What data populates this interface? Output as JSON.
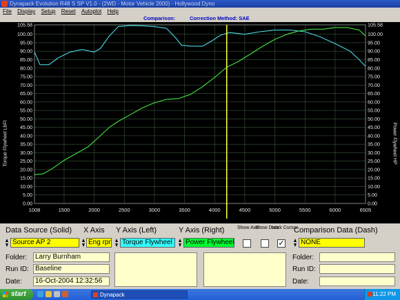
{
  "window": {
    "title": "Dynapack Evolution R48 S SP V1.0 - (2WD - Motor Vehicle 2000) - Hollywood Dyno"
  },
  "menu": [
    "File",
    "Display",
    "Setup",
    "Reset",
    "Autoplot",
    "Help"
  ],
  "comparison_bar": {
    "label": "Comparison:",
    "method": "Correction Method: SAE"
  },
  "colors": {
    "plot_bg": "#000000",
    "grid": "#3a5a3a",
    "torque": "#4ad8e8",
    "power": "#44e844",
    "cursor": "#ffff40",
    "field_yellow": "#ffff00",
    "field_cyan": "#33ffff",
    "field_green": "#00ff33"
  },
  "chart_data": {
    "type": "line",
    "title": "",
    "xlabel": "",
    "ylabel_left": "Torque Flywheel LbFt",
    "ylabel_right": "Power Flywheel HP",
    "xlim": [
      1008,
      6505
    ],
    "ylim": [
      0,
      105.58
    ],
    "x_ticks": [
      "1008",
      "1500",
      "2000",
      "2500",
      "3000",
      "3500",
      "4000",
      "4500",
      "5000",
      "5500",
      "6000",
      "6505"
    ],
    "y_ticks": [
      "105.58",
      "100.00",
      "95.00",
      "90.00",
      "85.00",
      "80.00",
      "75.00",
      "70.00",
      "65.00",
      "60.00",
      "55.00",
      "50.00",
      "45.00",
      "40.00",
      "35.00",
      "30.00",
      "25.00",
      "20.00",
      "15.00",
      "10.00",
      "5.00",
      "0.00"
    ],
    "cursor_x": 4200,
    "grid": true,
    "series": [
      {
        "name": "Torque Flywheel",
        "x": [
          1008,
          1100,
          1250,
          1400,
          1600,
          1800,
          2000,
          2100,
          2250,
          2400,
          2600,
          2800,
          3000,
          3200,
          3350,
          3450,
          3600,
          3800,
          3950,
          4100,
          4250,
          4500,
          4750,
          5000,
          5250,
          5500,
          5750,
          6000,
          6250,
          6400,
          6505
        ],
        "y": [
          89.5,
          82,
          82,
          86,
          89.5,
          91,
          89.5,
          91.5,
          99,
          104.5,
          105.2,
          105,
          104.5,
          103.5,
          98,
          93.5,
          93,
          93,
          96,
          99.5,
          101,
          100,
          101.5,
          102.5,
          102.5,
          101.5,
          98.5,
          94.5,
          90,
          85,
          81
        ]
      },
      {
        "name": "Power Flywheel",
        "x": [
          1008,
          1150,
          1300,
          1500,
          1700,
          1900,
          2100,
          2250,
          2400,
          2600,
          2800,
          3000,
          3200,
          3400,
          3600,
          3800,
          4000,
          4200,
          4400,
          4600,
          4800,
          5000,
          5200,
          5400,
          5600,
          5800,
          6000,
          6200,
          6400,
          6505
        ],
        "y": [
          17,
          17.5,
          20.5,
          25.5,
          29.5,
          33.5,
          40,
          45,
          48.5,
          52.5,
          56.5,
          59.5,
          61.5,
          62,
          64.5,
          69,
          74.5,
          80.5,
          84,
          88.5,
          93,
          97,
          100,
          102,
          103,
          103,
          104,
          104,
          102.5,
          99
        ]
      }
    ]
  },
  "panel": {
    "data_source_header": "Data Source (Solid)",
    "x_axis_header": "X Axis",
    "y_left_header": "Y Axis (Left)",
    "y_right_header": "Y Axis (Right)",
    "show_ave": "Show Ave.",
    "show_data": "Show Data",
    "lock_cursor": "Lock Cursor",
    "comparison_header": "Comparison Data (Dash)",
    "source_value": "Source AP 2",
    "x_axis_value": "Eng rpm",
    "y_left_value": "Torque Flywheel",
    "y_right_value": "Power Flywheel",
    "comparison_value": "NONE",
    "lock_cursor_mark": "✓",
    "folder_label": "Folder:",
    "runid_label": "Run ID:",
    "date_label": "Date:",
    "folder_value": "Larry Burnham",
    "runid_value": "Baseline",
    "date_value": "16-Oct-2004  12:32:56"
  },
  "taskbar": {
    "start": "start",
    "task": "Dynapack",
    "clock": "11:22 PM"
  }
}
